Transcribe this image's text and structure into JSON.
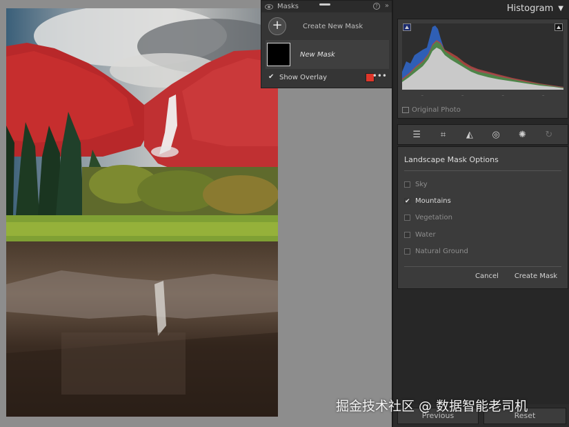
{
  "masks_panel": {
    "title": "Masks",
    "help_icon": "?",
    "collapse_icon": "»",
    "create_label": "Create New Mask",
    "create_icon": "+",
    "mask_name": "New Mask",
    "show_overlay_label": "Show Overlay",
    "show_overlay_checked": true,
    "overlay_color": "#e0362a",
    "more_icon": "•••"
  },
  "histogram": {
    "title": "Histogram",
    "collapse_icon": "▼",
    "ticks": [
      "–",
      "–",
      "–",
      "–"
    ],
    "original_photo_label": "Original Photo"
  },
  "tools": [
    "sliders-icon",
    "crop-icon",
    "healing-eraser-icon",
    "red-eye-icon",
    "masking-icon",
    "presets-icon"
  ],
  "landscape_options": {
    "title": "Landscape Mask Options",
    "items": [
      {
        "label": "Sky",
        "checked": false
      },
      {
        "label": "Mountains",
        "checked": true
      },
      {
        "label": "Vegetation",
        "checked": false
      },
      {
        "label": "Water",
        "checked": false
      },
      {
        "label": "Natural Ground",
        "checked": false
      }
    ],
    "cancel_label": "Cancel",
    "create_label": "Create Mask"
  },
  "bottom": {
    "previous_label": "Previous",
    "reset_label": "Reset"
  },
  "watermark": "掘金技术社区 @ 数据智能老司机",
  "colors": {
    "overlay_red": "#c8262b",
    "panel_bg": "#3b3b3b",
    "app_bg": "#272727"
  }
}
